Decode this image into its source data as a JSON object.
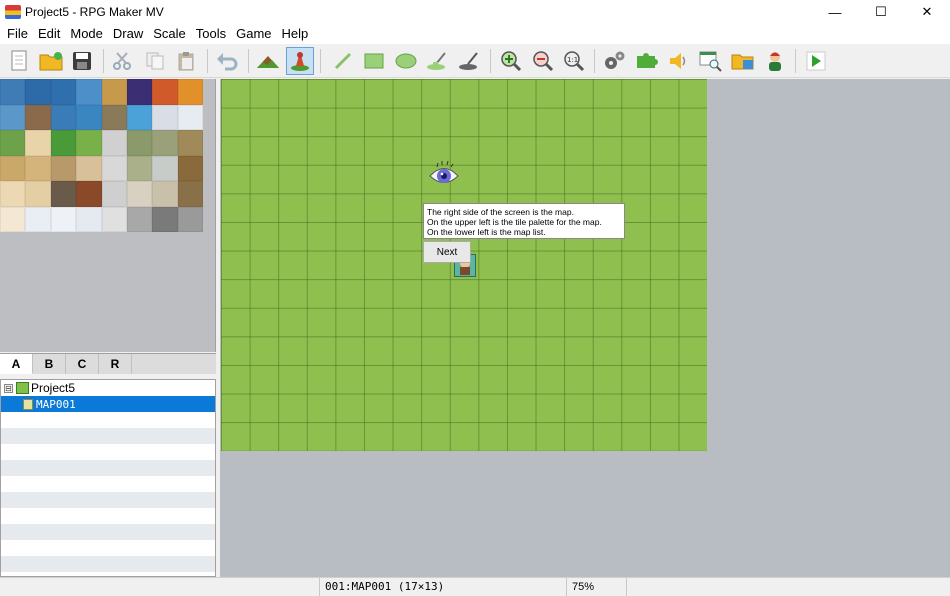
{
  "window": {
    "title": "Project5 - RPG Maker MV",
    "minimize": "—",
    "maximize": "☐",
    "close": "✕"
  },
  "menu": [
    "File",
    "Edit",
    "Mode",
    "Draw",
    "Scale",
    "Tools",
    "Game",
    "Help"
  ],
  "toolbar": {
    "buttons": [
      {
        "name": "new-project",
        "icon": "new-document-icon"
      },
      {
        "name": "open-project",
        "icon": "open-folder-icon"
      },
      {
        "name": "save-project",
        "icon": "floppy-disk-icon"
      },
      {
        "name": "cut",
        "icon": "scissors-icon"
      },
      {
        "name": "copy",
        "icon": "copy-icon"
      },
      {
        "name": "paste",
        "icon": "paste-icon"
      },
      {
        "name": "undo",
        "icon": "undo-icon"
      },
      {
        "name": "map-mode",
        "icon": "terrain-icon"
      },
      {
        "name": "event-mode",
        "icon": "event-pin-icon",
        "active": true
      },
      {
        "name": "pencil",
        "icon": "pencil-icon"
      },
      {
        "name": "rectangle",
        "icon": "rectangle-icon"
      },
      {
        "name": "ellipse",
        "icon": "ellipse-icon"
      },
      {
        "name": "fill",
        "icon": "fill-icon"
      },
      {
        "name": "shadow-pen",
        "icon": "shadow-pen-icon"
      },
      {
        "name": "zoom-in",
        "icon": "zoom-in-icon"
      },
      {
        "name": "zoom-out",
        "icon": "zoom-out-icon"
      },
      {
        "name": "actual-size",
        "icon": "zoom-actual-icon"
      },
      {
        "name": "database",
        "icon": "gears-icon"
      },
      {
        "name": "plugin-manager",
        "icon": "puzzle-icon"
      },
      {
        "name": "sound-test",
        "icon": "speaker-icon"
      },
      {
        "name": "event-searcher",
        "icon": "search-window-icon"
      },
      {
        "name": "resource-manager",
        "icon": "folder-resources-icon"
      },
      {
        "name": "character-generator",
        "icon": "character-icon"
      },
      {
        "name": "playtest",
        "icon": "play-icon"
      }
    ]
  },
  "palette": {
    "tabs": [
      "A",
      "B",
      "C",
      "R"
    ],
    "active_tab": "A"
  },
  "maplist": {
    "project": "Project5",
    "expander": "⊟",
    "maps": [
      "MAP001"
    ]
  },
  "map": {
    "tooltip_lines": [
      "The right side of the screen is the map.",
      "On the upper left is the tile palette for the map.",
      "On the lower left is the map list."
    ],
    "next_label": "Next"
  },
  "status": {
    "map_info": "001:MAP001 (17×13)",
    "zoom": "75%"
  },
  "colors": {
    "grass": "#8fc04f",
    "selection": "#0b79d7",
    "map_background": "#b8bcc3"
  }
}
